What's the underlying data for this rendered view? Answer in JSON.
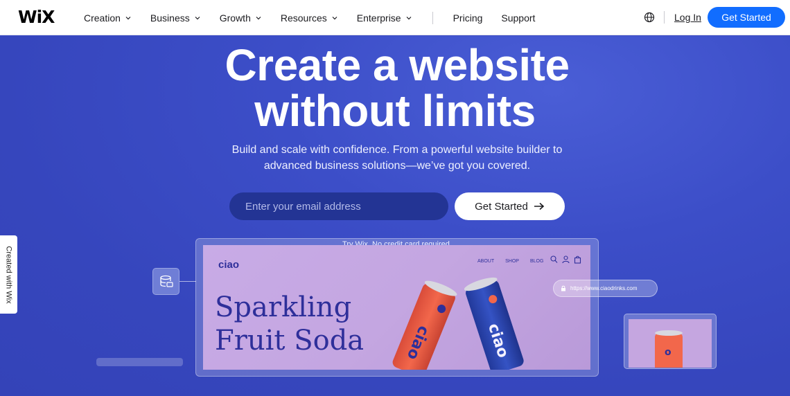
{
  "nav": {
    "logo": "WiX",
    "links": [
      "Creation",
      "Business",
      "Growth",
      "Resources",
      "Enterprise"
    ],
    "plain_links": [
      "Pricing",
      "Support"
    ],
    "login": "Log In",
    "cta": "Get Started"
  },
  "hero": {
    "title_line1": "Create a website",
    "title_line2": "without limits",
    "subtitle_line1": "Build and scale with confidence. From a powerful website builder to",
    "subtitle_line2": "advanced business solutions—we’ve got you covered.",
    "email_placeholder": "Enter your email address",
    "cta": "Get Started",
    "note": "Try Wix. No credit card required."
  },
  "side_tab": {
    "label": "Created with Wix"
  },
  "mockup": {
    "logo": "ciao",
    "nav": [
      "ABOUT",
      "SHOP",
      "BLOG"
    ],
    "title_line1": "Sparkling",
    "title_line2": "Fruit Soda",
    "url": "https://www.ciaodrinks.com",
    "can_brand": "ciao"
  },
  "colors": {
    "hero_bg": "#3a4bc5",
    "primary_blue": "#116dff",
    "email_field_bg": "#233494",
    "mockup_bg": "#c8abe6",
    "mockup_text": "#2e2f9a",
    "can_orange": "#f2674b",
    "can_blue": "#2f4fbf"
  }
}
